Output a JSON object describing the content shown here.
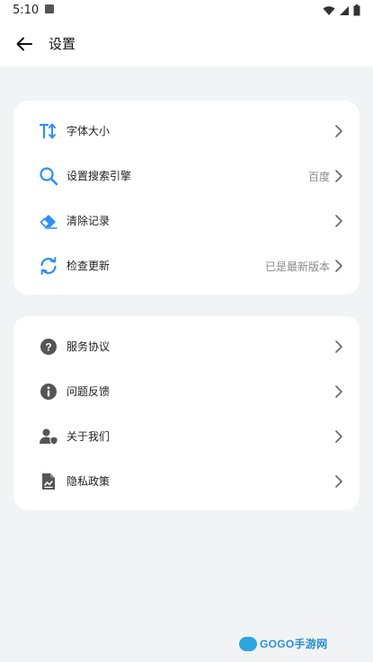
{
  "status_bar": {
    "time": "5:10"
  },
  "header": {
    "title": "设置"
  },
  "group1": [
    {
      "label": "字体大小",
      "value": "",
      "icon": "text-size-icon"
    },
    {
      "label": "设置搜索引擎",
      "value": "百度",
      "icon": "search-icon"
    },
    {
      "label": "清除记录",
      "value": "",
      "icon": "eraser-icon"
    },
    {
      "label": "检查更新",
      "value": "已是最新版本",
      "icon": "refresh-icon"
    }
  ],
  "group2": [
    {
      "label": "服务协议",
      "icon": "question-icon"
    },
    {
      "label": "问题反馈",
      "icon": "info-icon"
    },
    {
      "label": "关于我们",
      "icon": "user-shield-icon"
    },
    {
      "label": "隐私政策",
      "icon": "document-icon"
    }
  ],
  "watermark": {
    "text": "GOGO手游网"
  },
  "colors": {
    "accent_blue": "#2f8ef4",
    "icon_gray": "#555555",
    "background": "#f2f3f5"
  }
}
